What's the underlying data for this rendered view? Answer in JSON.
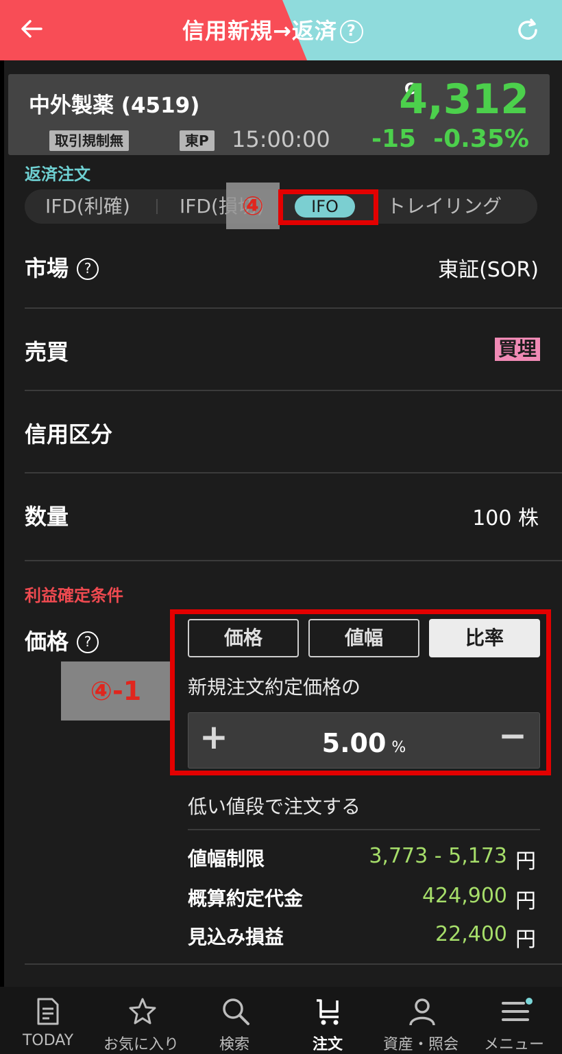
{
  "header": {
    "title": "信用新規→返済",
    "help": "?"
  },
  "stock": {
    "name": "中外製薬 (4519)",
    "tag_restriction": "取引規制無",
    "tag_market": "東P",
    "time": "15:00:00",
    "price_flag": "C",
    "price": "4,312",
    "change": "-15",
    "change_pct": "-0.35%",
    "up_down_color": "#4cd04c"
  },
  "order": {
    "section_label": "返済注文",
    "tabs": [
      "IFD(利確)",
      "IFD(損切)",
      "IFO",
      "トレイリング"
    ],
    "tab2_visible": "IFD(損",
    "tab2_tail": "切)",
    "selected_tab": "IFO"
  },
  "annotations": {
    "step4": "④",
    "step4_1": "④-1",
    "highlight_color": "#e30000"
  },
  "rows": {
    "market_label": "市場",
    "market_value": "東証(SOR)",
    "trade_label": "売買",
    "trade_value": "買埋",
    "credit_label": "信用区分",
    "qty_label": "数量",
    "qty_value": "100 株"
  },
  "profit": {
    "section_label": "利益確定条件",
    "price_label": "価格",
    "modes": [
      "価格",
      "値幅",
      "比率"
    ],
    "selected_mode": "比率",
    "desc": "新規注文約定価格の",
    "stepper_value": "5.00",
    "stepper_unit": "%",
    "plus": "+",
    "minus": "−",
    "direction": "低い値段で注文する"
  },
  "summary": [
    {
      "label": "値幅制限",
      "value": "3,773 - 5,173",
      "unit": "円"
    },
    {
      "label": "概算約定代金",
      "value": "424,900",
      "unit": "円"
    },
    {
      "label": "見込み損益",
      "value": "22,400",
      "unit": "円"
    }
  ],
  "nav": [
    {
      "label": "TODAY",
      "icon": "document-icon"
    },
    {
      "label": "お気に入り",
      "icon": "star-icon"
    },
    {
      "label": "検索",
      "icon": "search-icon"
    },
    {
      "label": "注文",
      "icon": "cart-icon"
    },
    {
      "label": "資産・照会",
      "icon": "person-icon"
    },
    {
      "label": "メニュー",
      "icon": "menu-icon"
    }
  ],
  "nav_active": "注文"
}
